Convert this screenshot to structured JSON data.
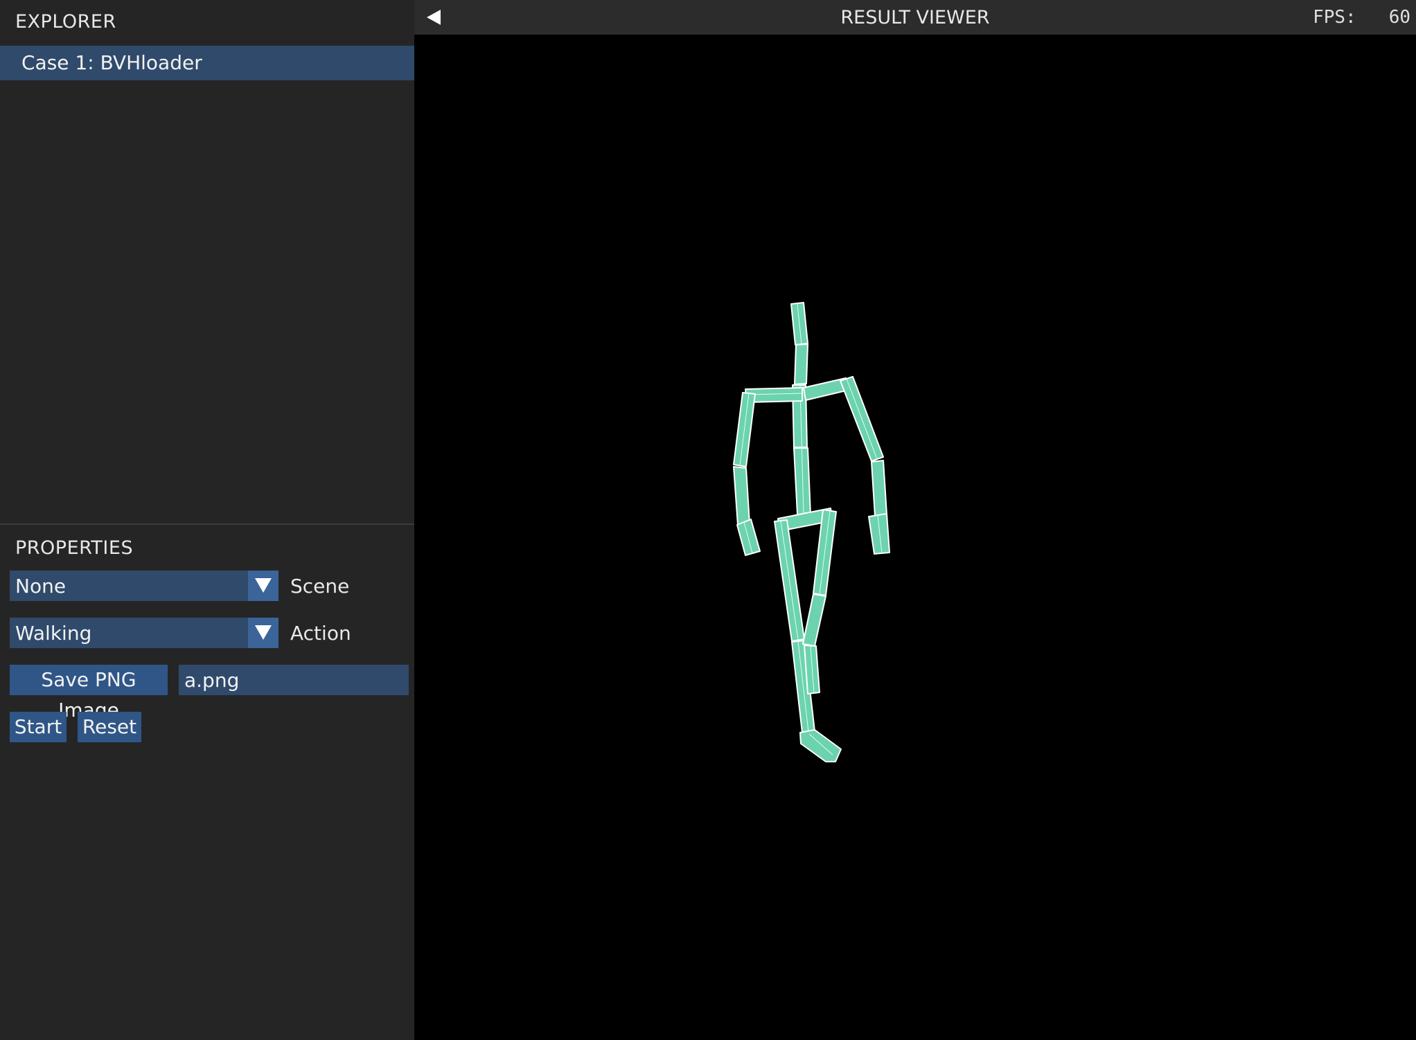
{
  "explorer": {
    "title": "EXPLORER",
    "items": [
      {
        "label": "Case 1: BVHloader"
      }
    ]
  },
  "properties": {
    "title": "PROPERTIES",
    "scene": {
      "value": "None",
      "label": "Scene"
    },
    "action": {
      "value": "Walking",
      "label": "Action"
    },
    "save_button": "Save PNG Image",
    "filename": "a.png",
    "start_button": "Start",
    "reset_button": "Reset"
  },
  "viewer": {
    "title": "RESULT VIEWER",
    "fps_label": "FPS:",
    "fps_value": "60"
  },
  "colors": {
    "panel_bg": "#252526",
    "selected_bg": "#2f4a6b",
    "button_bg": "#2f5687",
    "bone_fill": "#6cd3ae",
    "bone_edge": "#ffffff"
  },
  "icons": {
    "collapse": "triangle-left-icon",
    "dropdown": "triangle-down-icon"
  }
}
